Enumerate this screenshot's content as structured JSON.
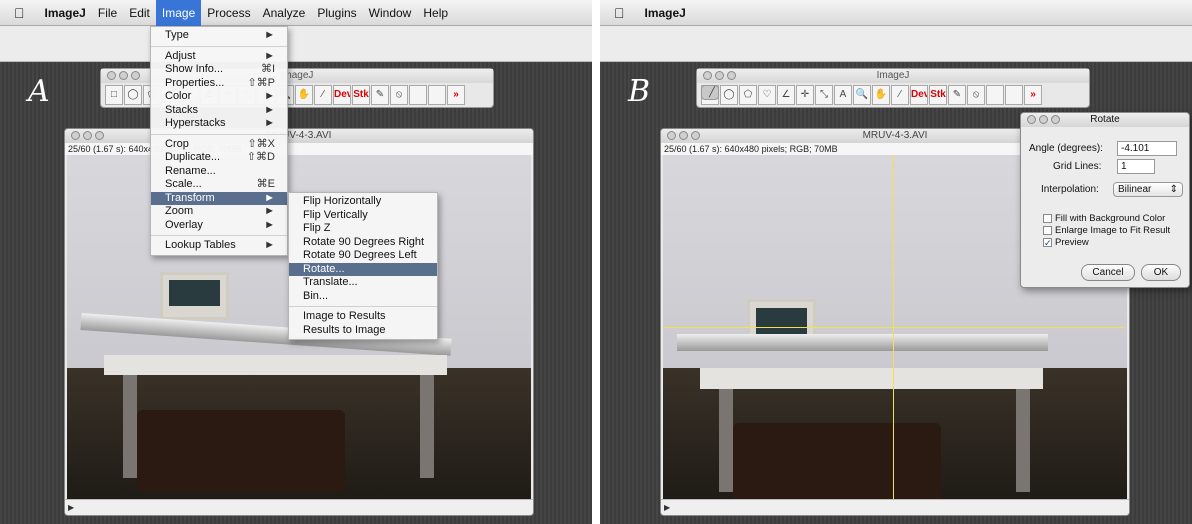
{
  "panel_a": {
    "letter": "A",
    "menubar": {
      "items": [
        {
          "label": "ImageJ"
        },
        {
          "label": "File"
        },
        {
          "label": "Edit"
        },
        {
          "label": "Image"
        },
        {
          "label": "Process"
        },
        {
          "label": "Analyze"
        },
        {
          "label": "Plugins"
        },
        {
          "label": "Window"
        },
        {
          "label": "Help"
        }
      ]
    },
    "toolbar_title": "ImageJ",
    "tools": [
      "□",
      "◯",
      "⬠",
      "♡",
      "╱",
      "∠",
      "✛",
      "⤡",
      "A",
      "🔍",
      "✋",
      "⁄",
      "Dev",
      "Stk",
      "✎",
      "⦸",
      "",
      "",
      "»"
    ],
    "image_window": {
      "title": "MRUV-4-3.AVI",
      "info": "25/60 (1.67 s): 640x480 pixels; RGB; 70MB"
    },
    "image_menu": {
      "items": [
        {
          "label": "Type",
          "shortcut": "►"
        },
        {
          "label": "Adjust",
          "shortcut": "►"
        },
        {
          "label": "Show Info...",
          "shortcut": "⌘I"
        },
        {
          "label": "Properties...",
          "shortcut": "⇧⌘P"
        },
        {
          "label": "Color",
          "shortcut": "►"
        },
        {
          "label": "Stacks",
          "shortcut": "►"
        },
        {
          "label": "Hyperstacks",
          "shortcut": "►"
        },
        {
          "label": "Crop",
          "shortcut": "⇧⌘X"
        },
        {
          "label": "Duplicate...",
          "shortcut": "⇧⌘D"
        },
        {
          "label": "Rename...",
          "shortcut": ""
        },
        {
          "label": "Scale...",
          "shortcut": "⌘E"
        },
        {
          "label": "Transform",
          "shortcut": "►"
        },
        {
          "label": "Zoom",
          "shortcut": "►"
        },
        {
          "label": "Overlay",
          "shortcut": "►"
        },
        {
          "label": "Lookup Tables",
          "shortcut": "►"
        }
      ]
    },
    "transform_menu": {
      "items": [
        {
          "label": "Flip Horizontally"
        },
        {
          "label": "Flip Vertically"
        },
        {
          "label": "Flip Z"
        },
        {
          "label": "Rotate 90 Degrees Right"
        },
        {
          "label": "Rotate 90 Degrees Left"
        },
        {
          "label": "Rotate..."
        },
        {
          "label": "Translate..."
        },
        {
          "label": "Bin..."
        },
        {
          "label": "Image to Results"
        },
        {
          "label": "Results to Image"
        }
      ]
    }
  },
  "panel_b": {
    "letter": "B",
    "menubar": {
      "app": "ImageJ"
    },
    "toolbar_title": "ImageJ",
    "tools": [
      "□",
      "◯",
      "⬠",
      "♡",
      "╱",
      "∠",
      "✛",
      "⤡",
      "A",
      "🔍",
      "✋",
      "⁄",
      "Dev",
      "Stk",
      "✎",
      "⦸",
      "",
      "",
      "»"
    ],
    "image_window": {
      "title": "MRUV-4-3.AVI",
      "info": "25/60 (1.67 s): 640x480 pixels; RGB; 70MB"
    },
    "rotate_dialog": {
      "title": "Rotate",
      "angle_label": "Angle (degrees):",
      "angle_value": "-4.101",
      "grid_label": "Grid Lines:",
      "grid_value": "1",
      "interp_label": "Interpolation:",
      "interp_value": "Bilinear",
      "fill_label": "Fill with Background Color",
      "enlarge_label": "Enlarge Image to Fit Result",
      "preview_label": "Preview",
      "cancel_label": "Cancel",
      "ok_label": "OK"
    }
  }
}
